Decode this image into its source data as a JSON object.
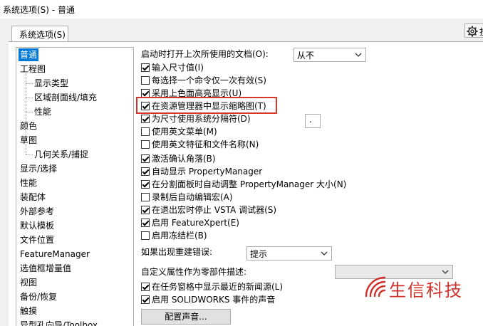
{
  "window": {
    "title": "系统选项(S) - 普通"
  },
  "tabs": [
    {
      "label": "系统选项(S)"
    }
  ],
  "toolbar": {
    "gear_partial_text": "搜"
  },
  "tree": [
    {
      "label": "普通",
      "selected": true
    },
    {
      "label": "工程图"
    },
    {
      "label": "显示类型",
      "child": true
    },
    {
      "label": "区域剖面线/填充",
      "child": true
    },
    {
      "label": "性能",
      "child": true
    },
    {
      "label": "颜色"
    },
    {
      "label": "草图"
    },
    {
      "label": "几何关系/捕捉",
      "child": true
    },
    {
      "label": "显示/选择"
    },
    {
      "label": "性能"
    },
    {
      "label": "装配体"
    },
    {
      "label": "外部参考"
    },
    {
      "label": "默认模板"
    },
    {
      "label": "文件位置"
    },
    {
      "label": "FeatureManager"
    },
    {
      "label": "选值框增量值"
    },
    {
      "label": "视图"
    },
    {
      "label": "备份/恢复"
    },
    {
      "label": "触摸"
    },
    {
      "label": "异型孔向导/Toolbox"
    }
  ],
  "general": {
    "open_last_label": "启动时打开上次所使用的文档(O):",
    "open_last_value": "从不",
    "checkboxes": [
      {
        "label": "输入尺寸值(I)",
        "checked": true
      },
      {
        "label": "每选择一个命令仅一次有效(S)",
        "checked": false
      },
      {
        "label": "采用上色面高亮显示(U)",
        "checked": true
      },
      {
        "label": "在资源管理器中显示缩略图(T)",
        "checked": true
      },
      {
        "label": "为尺寸使用系统分隔符(D)",
        "checked": true
      },
      {
        "label": "使用英文菜单(M)",
        "checked": false
      },
      {
        "label": "使用英文特征和文件名称(N)",
        "checked": false
      },
      {
        "label": "激活确认角落(B)",
        "checked": true
      },
      {
        "label": "自动显示 PropertyManager",
        "checked": true
      },
      {
        "label": "在分割面板时自动调整 PropertyManager 大小(N)",
        "checked": true
      },
      {
        "label": "录制后自动编辑宏(A)",
        "checked": false
      },
      {
        "label": "在退出宏时停止 VSTA 调试器(S)",
        "checked": true
      },
      {
        "label": "启用 FeatureXpert(E)",
        "checked": true
      },
      {
        "label": "启用冻结栏(B)",
        "checked": false
      }
    ],
    "separator_value": ".",
    "rebuild_error_label": "如果出现重建错误:",
    "rebuild_error_value": "提示",
    "custom_prop_label": "自定义属性作为零部件描述:",
    "custom_prop_value": "",
    "checkboxes2": [
      {
        "label": "在任务窗格中显示最近的新闻源(L)",
        "checked": true
      },
      {
        "label": "启用 SOLIDWORKS 事件的声音",
        "checked": true
      }
    ],
    "sound_button": "配置声音..."
  },
  "watermark": {
    "text": "生信科技"
  },
  "colors": {
    "selection": "#0078d7",
    "highlight_border": "#d9352b",
    "watermark": "#d0302a"
  }
}
